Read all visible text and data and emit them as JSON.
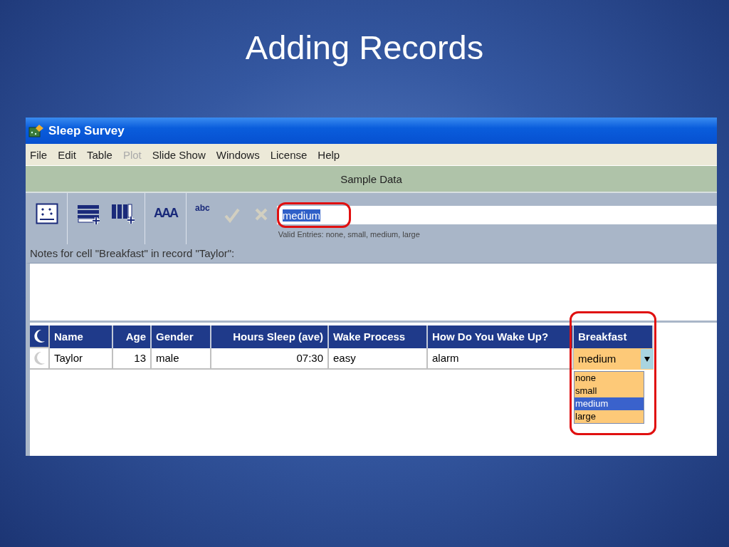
{
  "slide": {
    "title": "Adding Records"
  },
  "window": {
    "title": "Sleep Survey"
  },
  "menu": [
    {
      "label": "File",
      "disabled": false
    },
    {
      "label": "Edit",
      "disabled": false
    },
    {
      "label": "Table",
      "disabled": false
    },
    {
      "label": "Plot",
      "disabled": true
    },
    {
      "label": "Slide Show",
      "disabled": false
    },
    {
      "label": "Windows",
      "disabled": false
    },
    {
      "label": "License",
      "disabled": false
    },
    {
      "label": "Help",
      "disabled": false
    }
  ],
  "tabs": [
    {
      "label": "Sample Data",
      "selected": true
    }
  ],
  "toolbar": {
    "text_buttons": [
      "AAA",
      "abc"
    ],
    "edit_actions_disabled": true,
    "entry_value": "medium",
    "valid_entries": "Valid Entries: none, small, medium, large"
  },
  "notes": {
    "label": "Notes for cell \"Breakfast\" in record \"Taylor\":"
  },
  "table": {
    "columns": [
      {
        "label": "Name",
        "kind": "text"
      },
      {
        "label": "Age",
        "kind": "number"
      },
      {
        "label": "Gender",
        "kind": "text"
      },
      {
        "label": "Hours Sleep (ave)",
        "kind": "number"
      },
      {
        "label": "Wake Process",
        "kind": "text"
      },
      {
        "label": "How Do You Wake Up?",
        "kind": "text"
      },
      {
        "label": "Breakfast",
        "kind": "choice"
      }
    ],
    "rows": [
      {
        "cells": [
          "Taylor",
          "13",
          "male",
          "07:30",
          "easy",
          "alarm",
          "medium"
        ]
      }
    ]
  },
  "dropdown": {
    "options": [
      {
        "label": "none",
        "selected": false
      },
      {
        "label": "small",
        "selected": false
      },
      {
        "label": "medium",
        "selected": true
      },
      {
        "label": "large",
        "selected": false
      }
    ]
  }
}
